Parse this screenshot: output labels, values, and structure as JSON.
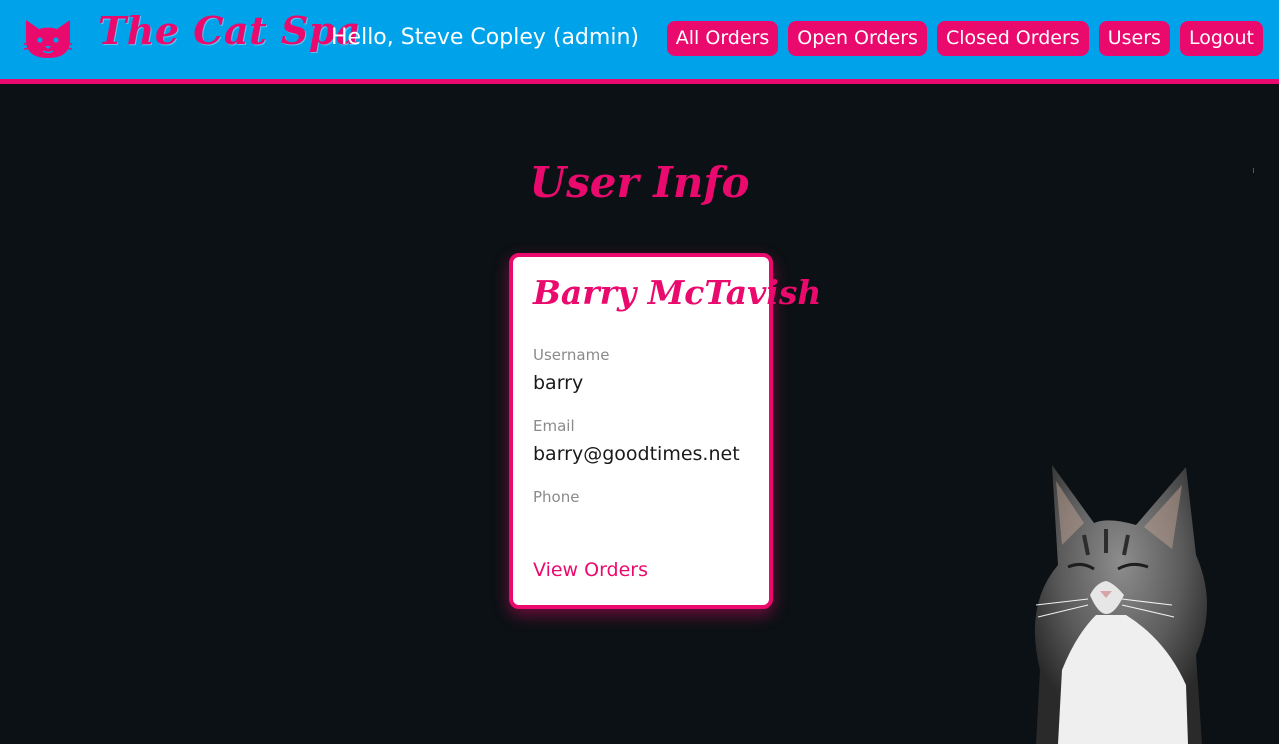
{
  "header": {
    "brand": "The Cat Spa",
    "greeting": "Hello, Steve Copley (admin)",
    "nav": [
      {
        "label": "All Orders"
      },
      {
        "label": "Open Orders"
      },
      {
        "label": "Closed Orders"
      },
      {
        "label": "Users"
      },
      {
        "label": "Logout"
      }
    ]
  },
  "page": {
    "title": "User Info"
  },
  "user": {
    "name": "Barry McTavish",
    "username_label": "Username",
    "username": "barry",
    "email_label": "Email",
    "email": "barry@goodtimes.net",
    "phone_label": "Phone",
    "phone": "",
    "view_orders": "View Orders"
  },
  "colors": {
    "header_bg": "#00a3ea",
    "accent": "#ea0a6e",
    "page_bg": "#0b1114"
  },
  "icons": {
    "logo": "cat-face-icon"
  }
}
